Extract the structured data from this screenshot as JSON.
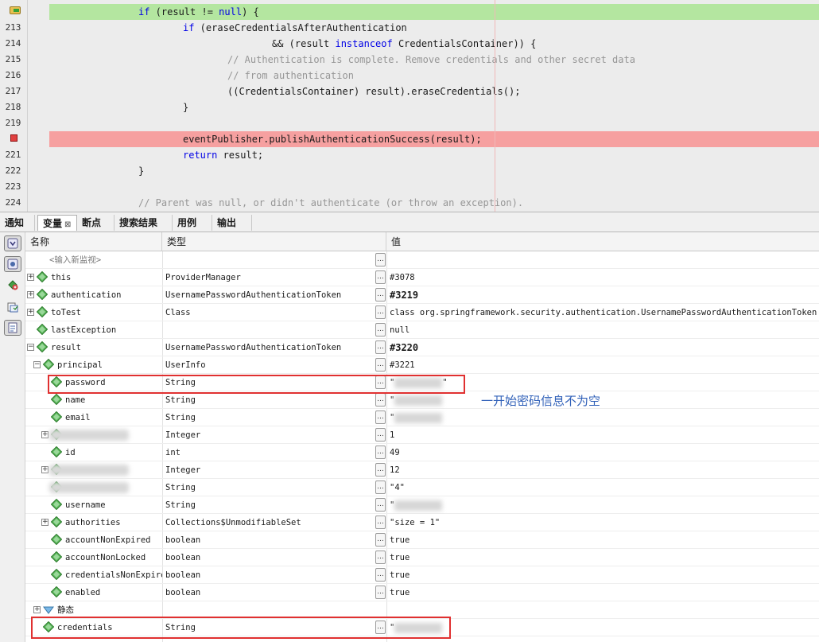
{
  "editor": {
    "lines": [
      {
        "num": "",
        "marker": "pc",
        "highlight": "green",
        "segments": [
          {
            "t": "if",
            "c": "kw"
          },
          {
            "t": " (result != "
          },
          {
            "t": "null",
            "c": "kw"
          },
          {
            "t": ") {"
          }
        ]
      },
      {
        "num": "213",
        "segments": [
          {
            "t": "if",
            "c": "kw"
          },
          {
            "t": " (eraseCredentialsAfterAuthentication"
          }
        ]
      },
      {
        "num": "214",
        "segments": [
          {
            "t": "&& (result "
          },
          {
            "t": "instanceof",
            "c": "kw"
          },
          {
            "t": " CredentialsContainer)) {"
          }
        ]
      },
      {
        "num": "215",
        "segments": [
          {
            "t": "// Authentication is complete. Remove credentials and other secret data",
            "c": "cm"
          }
        ]
      },
      {
        "num": "216",
        "segments": [
          {
            "t": "// from authentication",
            "c": "cm"
          }
        ]
      },
      {
        "num": "217",
        "segments": [
          {
            "t": "((CredentialsContainer) result).eraseCredentials();"
          }
        ]
      },
      {
        "num": "218",
        "segments": [
          {
            "t": "}"
          }
        ]
      },
      {
        "num": "219",
        "segments": []
      },
      {
        "num": "",
        "marker": "breakpoint",
        "highlight": "red",
        "segments": [
          {
            "t": "eventPublisher.publishAuthenticationSuccess(result);"
          }
        ]
      },
      {
        "num": "221",
        "segments": [
          {
            "t": "return",
            "c": "kw"
          },
          {
            "t": " result;"
          }
        ]
      },
      {
        "num": "222",
        "segments": [
          {
            "t": "}"
          }
        ]
      },
      {
        "num": "223",
        "segments": []
      },
      {
        "num": "224",
        "segments": [
          {
            "t": "// Parent was null, or didn't authenticate (or throw an exception).",
            "c": "cm"
          }
        ]
      }
    ]
  },
  "tabs": [
    {
      "label": "通知",
      "active": false
    },
    {
      "label": "变量",
      "active": true,
      "close": "⊠"
    },
    {
      "label": "断点",
      "active": false
    },
    {
      "label": "搜索结果",
      "active": false
    },
    {
      "label": "用例",
      "active": false
    },
    {
      "label": "输出",
      "active": false
    }
  ],
  "toolbar_icons": [
    "show-hide-icon",
    "watch-icon",
    "new-watch-icon",
    "copy-icon",
    "properties-icon"
  ],
  "table": {
    "headers": {
      "name": "名称",
      "type": "类型",
      "value": "值"
    },
    "rows": [
      {
        "level": 0,
        "name": "<输入新监视>",
        "type": "",
        "value": "",
        "ghost": true,
        "noicon": true,
        "expander": ""
      },
      {
        "level": 0,
        "name": "this",
        "type": "ProviderManager",
        "value": "#3078",
        "expander": "+"
      },
      {
        "level": 0,
        "name": "authentication",
        "type": "UsernamePasswordAuthenticationToken",
        "value": "#3219",
        "bold": true,
        "expander": "+"
      },
      {
        "level": 0,
        "name": "toTest",
        "type": "Class",
        "value": "class org.springframework.security.authentication.UsernamePasswordAuthenticationToken",
        "expander": "+"
      },
      {
        "level": 0,
        "name": "lastException",
        "type": "",
        "value": "null",
        "expander": ""
      },
      {
        "level": 0,
        "name": "result",
        "type": "UsernamePasswordAuthenticationToken",
        "value": "#3220",
        "bold": true,
        "expander": "−"
      },
      {
        "level": 1,
        "name": "principal",
        "type": "UserInfo",
        "value": "#3221",
        "expander": "−"
      },
      {
        "level": 2,
        "name": "password",
        "type": "String",
        "value": "\"",
        "value_suffix": "\"",
        "blur_value": true,
        "expander": ""
      },
      {
        "level": 2,
        "name": "name",
        "type": "String",
        "value": "\"",
        "blur_value": true,
        "expander": ""
      },
      {
        "level": 2,
        "name": "email",
        "type": "String",
        "value": "\"",
        "blur_value": true,
        "expander": ""
      },
      {
        "level": 2,
        "name": "",
        "type": "Integer",
        "value": "1",
        "blur_name": true,
        "expander": "+"
      },
      {
        "level": 2,
        "name": "id",
        "type": "int",
        "value": "49",
        "expander": ""
      },
      {
        "level": 2,
        "name": "",
        "type": "Integer",
        "value": "12",
        "blur_name": true,
        "expander": "+"
      },
      {
        "level": 2,
        "name": "",
        "type": "String",
        "value": "\"4\"",
        "blur_name": true,
        "expander": ""
      },
      {
        "level": 2,
        "name": "username",
        "type": "String",
        "value": "\"",
        "blur_value": true,
        "expander": ""
      },
      {
        "level": 2,
        "name": "authorities",
        "type": "Collections$UnmodifiableSet",
        "value": "\"size = 1\"",
        "expander": "+"
      },
      {
        "level": 2,
        "name": "accountNonExpired",
        "type": "boolean",
        "value": "true",
        "expander": ""
      },
      {
        "level": 2,
        "name": "accountNonLocked",
        "type": "boolean",
        "value": "true",
        "expander": ""
      },
      {
        "level": 2,
        "name": "credentialsNonExpired",
        "type": "boolean",
        "value": "true",
        "expander": ""
      },
      {
        "level": 2,
        "name": "enabled",
        "type": "boolean",
        "value": "true",
        "expander": ""
      },
      {
        "level": 1,
        "name": "静态",
        "type": "",
        "value": "",
        "static": true,
        "expander": "+"
      },
      {
        "level": 1,
        "name": "credentials",
        "type": "String",
        "value": "\"",
        "blur_value": true,
        "expander": ""
      }
    ]
  },
  "annotation": {
    "text": "一开始密码信息不为空",
    "color": "#3060b8"
  },
  "colors": {
    "keyword": "#0000e6",
    "comment": "#969696",
    "pc_line": "#b4e6a0",
    "breakpoint_line": "#f6a0a0",
    "annotation_box": "#e03030"
  }
}
